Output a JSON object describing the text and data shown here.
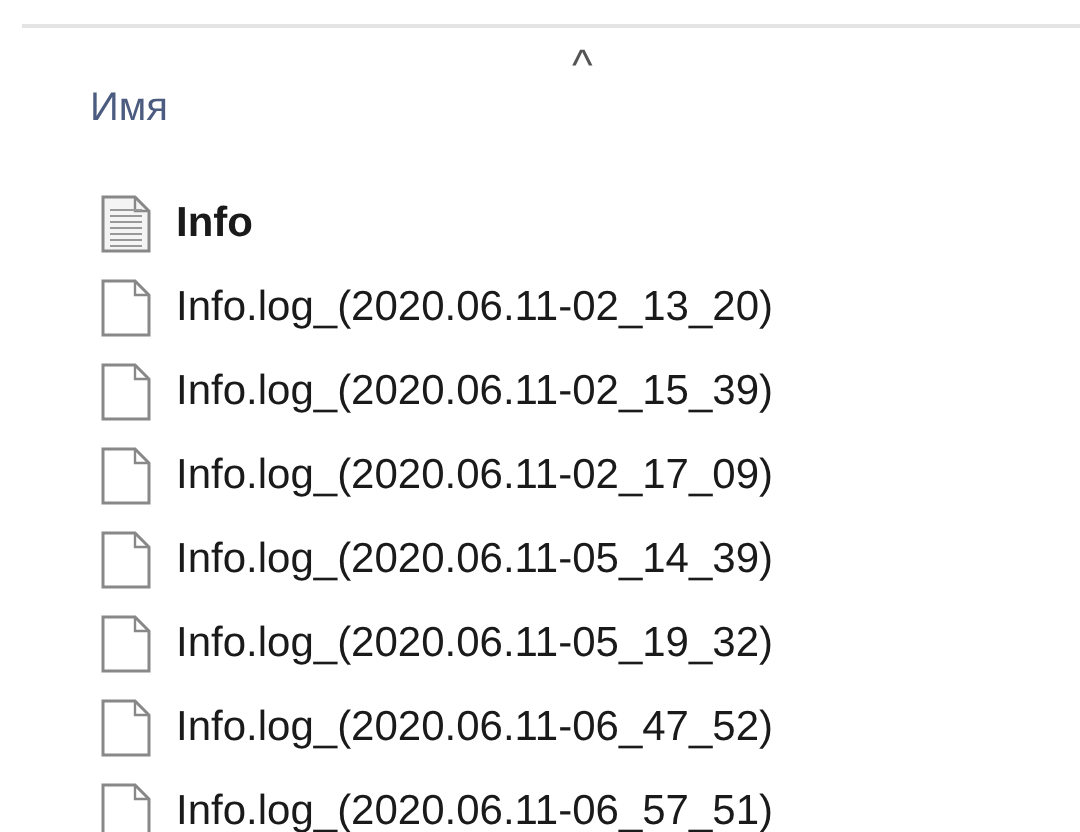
{
  "header": {
    "column": "Имя",
    "sort_arrow": "^"
  },
  "files": [
    {
      "name": "Info",
      "kind": "text"
    },
    {
      "name": "Info.log_(2020.06.11-02_13_20)",
      "kind": "blank"
    },
    {
      "name": "Info.log_(2020.06.11-02_15_39)",
      "kind": "blank"
    },
    {
      "name": "Info.log_(2020.06.11-02_17_09)",
      "kind": "blank"
    },
    {
      "name": "Info.log_(2020.06.11-05_14_39)",
      "kind": "blank"
    },
    {
      "name": "Info.log_(2020.06.11-05_19_32)",
      "kind": "blank"
    },
    {
      "name": "Info.log_(2020.06.11-06_47_52)",
      "kind": "blank"
    },
    {
      "name": "Info.log_(2020.06.11-06_57_51)",
      "kind": "blank"
    }
  ]
}
